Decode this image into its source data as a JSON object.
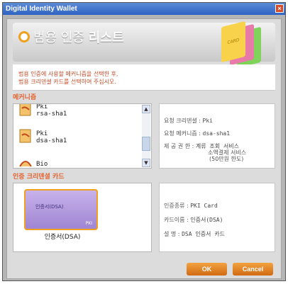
{
  "window": {
    "title": "Digital Identity Wallet",
    "close_symbol": "×"
  },
  "header": {
    "title_prefix": "범용 인증",
    "title_bold": "리스트",
    "card_text": "CARD"
  },
  "description": {
    "line1": "범용 인증에 사용할 메커니즘을 선택한 후,",
    "line2": "범용 크리덴셜 카드를 선택하여 주십시오."
  },
  "mechanism_section": {
    "label": "메커니즘",
    "items": [
      {
        "name": "Pki",
        "detail": "rsa-sha1"
      },
      {
        "name": "Pki",
        "detail": "dsa-sha1"
      },
      {
        "name": "Bio",
        "detail": ""
      }
    ],
    "scroll_up": "▲",
    "scroll_down": "▼"
  },
  "mechanism_info": {
    "row1_label": "요청 크리덴셜 :",
    "row1_value": "Pki",
    "row2_label": "요청 메커니즘 :",
    "row2_value": "dsa-sha1",
    "row3_label": "제 공 권 한 :",
    "row3_value1": "계류 조회 서비스",
    "row3_value2": "소액결제 서비스",
    "row3_value3": "(50만원 한도)"
  },
  "credential_section": {
    "label": "인증 크리덴셜 카드",
    "card_name": "인증서(DSA)",
    "card_badge": "PKI",
    "card_caption": "인증서(DSA)"
  },
  "credential_info": {
    "row1_label": "인증종류 :",
    "row1_value": "PKI Card",
    "row2_label": "카드이름 :",
    "row2_value": "인증서(DSA)",
    "row3_label": "설    명 :",
    "row3_value": "DSA 인증서 카드"
  },
  "buttons": {
    "ok": "OK",
    "cancel": "Cancel"
  },
  "colors": {
    "accent": "#f0a11d",
    "section_label": "#e4622e",
    "title_bar": "#2e63c2"
  }
}
